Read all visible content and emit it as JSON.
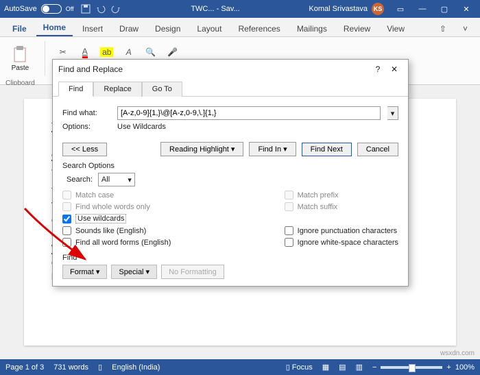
{
  "titlebar": {
    "autosave": "AutoSave",
    "autosave_state": "Off",
    "doc_name": "TWC... - Sav...",
    "user_name": "Komal Srivastava",
    "user_initials": "KS"
  },
  "ribbon": {
    "tabs": [
      "File",
      "Home",
      "Insert",
      "Draw",
      "Design",
      "Layout",
      "References",
      "Mailings",
      "Review",
      "View"
    ],
    "active": 1,
    "group_clipboard": "Clipboard",
    "paste": "Paste"
  },
  "document": {
    "p1_prefix": "TheWir",
    "p1_line2": "MVP. A",
    "p1_line3": "enthus",
    "p1_line4a": "at ",
    "p1_line4b": "thew",
    "p2_l1": "The sit",
    "p2_l2": "Vista u",
    "p2_l3": "operat",
    "p2_l4": "on 'as-",
    "p2_l5": "Webm",
    "p2_l6": "or indi",
    "p2_l7": "by the"
  },
  "dialog": {
    "title": "Find and Replace",
    "help": "?",
    "tabs": {
      "find": "Find",
      "replace": "Replace",
      "goto": "Go To"
    },
    "find_what_label": "Find what:",
    "find_what_value": "[A-z,0-9]{1,}\\@[A-z,0-9,\\.]{1,}",
    "options_label": "Options:",
    "options_value": "Use Wildcards",
    "btn_less": "<< Less",
    "btn_reading": "Reading Highlight ▾",
    "btn_findin": "Find In ▾",
    "btn_findnext": "Find Next",
    "btn_cancel": "Cancel",
    "search_options": "Search Options",
    "search_label": "Search:",
    "search_value": "All",
    "chk_matchcase": "Match case",
    "chk_wholewords": "Find whole words only",
    "chk_wildcards": "Use wildcards",
    "chk_sounds": "Sounds like (English)",
    "chk_wordforms": "Find all word forms (English)",
    "chk_prefix": "Match prefix",
    "chk_suffix": "Match suffix",
    "chk_ignorepunct": "Ignore punctuation characters",
    "chk_ignorews": "Ignore white-space characters",
    "find_section": "Find",
    "btn_format": "Format ▾",
    "btn_special": "Special ▾",
    "btn_noformatting": "No Formatting"
  },
  "status": {
    "page": "Page 1 of 3",
    "words": "731 words",
    "lang": "English (India)",
    "focus": "Focus",
    "zoom": "100%"
  },
  "watermark": "wsxdn.com"
}
